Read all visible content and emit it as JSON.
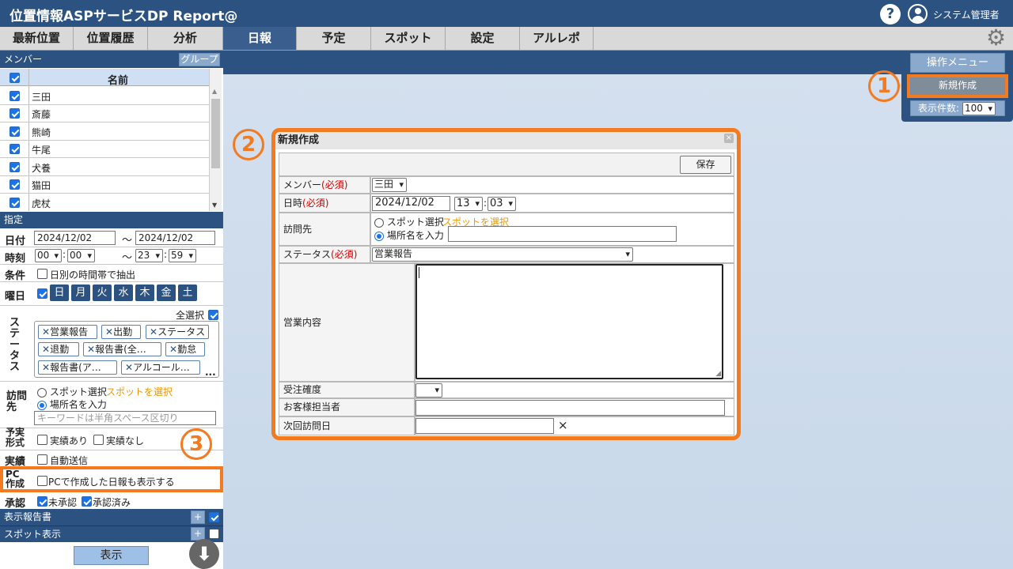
{
  "header": {
    "title": "位置情報ASPサービスDP Report@",
    "user": "システム管理者"
  },
  "tabs": [
    "最新位置",
    "位置履歴",
    "分析",
    "日報",
    "予定",
    "スポット",
    "設定",
    "アルレポ"
  ],
  "active_tab": "日報",
  "sidebar": {
    "members_title": "メンバー",
    "group_btn": "グループ",
    "col_name": "名前",
    "members": [
      "三田",
      "斎藤",
      "熊崎",
      "牛尾",
      "犬養",
      "猫田",
      "虎杖"
    ],
    "filter_title": "指定",
    "date_label": "日付",
    "date_from": "2024/12/02",
    "date_sep": "～",
    "date_to": "2024/12/02",
    "time_label": "時刻",
    "time_from_h": "00",
    "time_from_m": "00",
    "time_to_h": "23",
    "time_to_m": "59",
    "condition_label": "条件",
    "condition_text": "日別の時間帯で抽出",
    "weekday_label": "曜日",
    "weekdays": [
      "日",
      "月",
      "火",
      "水",
      "木",
      "金",
      "土"
    ],
    "status_label": "ステータス",
    "select_all": "全選択",
    "status_chips": [
      "営業報告",
      "出勤",
      "ステータス",
      "退勤",
      "報告書(全…",
      "勤怠",
      "報告書(ア…",
      "アルコール…"
    ],
    "more": "...",
    "visit_label": "訪問先",
    "spot_select": "スポット選択",
    "spot_link": "スポットを選択",
    "place_input": "場所名を入力",
    "keyword_placeholder": "キーワードは半角スペース区切り",
    "form_label": "予実形式",
    "actual_yes": "実績あり",
    "actual_no": "実績なし",
    "actual_label": "実績",
    "auto_send": "自動送信",
    "pc_label": "PC作成",
    "pc_text": "PCで作成した日報も表示する",
    "approval_label": "承認",
    "unapproved": "未承認",
    "approved": "承認済み",
    "report_display": "表示報告書",
    "spot_display": "スポット表示",
    "plus": "+",
    "show_btn": "表示"
  },
  "ops": {
    "menu": "操作メニュー",
    "new_btn": "新規作成",
    "count_label": "表示件数:",
    "count_value": "100"
  },
  "callouts": {
    "c1": "1",
    "c2": "2",
    "c3": "3"
  },
  "dialog": {
    "title": "新規作成",
    "close": "×",
    "save": "保存",
    "member_label": "メンバー",
    "required": "(必須)",
    "member_value": "三田",
    "datetime_label": "日時",
    "date_value": "2024/12/02",
    "hour": "13",
    "minute": "03",
    "time_sep": ":",
    "visit_label": "訪問先",
    "spot_select": "スポット選択",
    "spot_link": "スポットを選択",
    "place_input": "場所名を入力",
    "status_label": "ステータス",
    "status_value": "営業報告",
    "content_label": "営業内容",
    "order_label": "受注確度",
    "contact_label": "お客様担当者",
    "next_visit_label": "次回訪問日",
    "clear": "×"
  }
}
